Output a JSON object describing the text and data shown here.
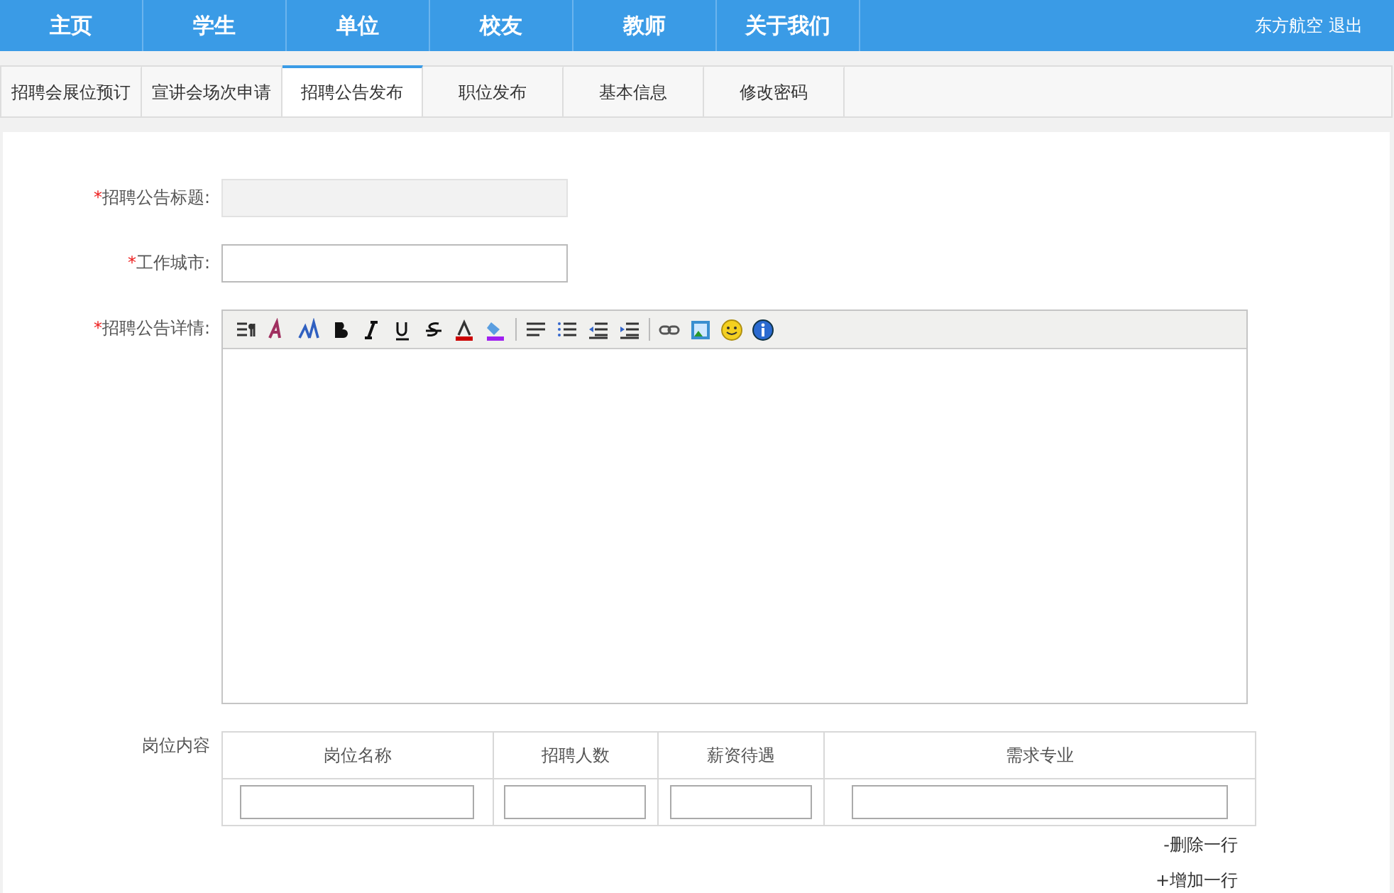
{
  "nav": {
    "items": [
      {
        "label": "主页",
        "selected": false
      },
      {
        "label": "学生",
        "selected": false
      },
      {
        "label": "单位",
        "selected": false
      },
      {
        "label": "校友",
        "selected": false
      },
      {
        "label": "教师",
        "selected": false
      },
      {
        "label": "关于我们",
        "selected": false
      }
    ],
    "user": "东方航空",
    "logout": "退出"
  },
  "tabs": [
    {
      "label": "招聘会展位预订",
      "selected": false
    },
    {
      "label": "宣讲会场次申请",
      "selected": false
    },
    {
      "label": "招聘公告发布",
      "selected": true
    },
    {
      "label": "职位发布",
      "selected": false
    },
    {
      "label": "基本信息",
      "selected": false
    },
    {
      "label": "修改密码",
      "selected": false
    }
  ],
  "form": {
    "fields": [
      {
        "kind": "input",
        "required_mark": "*",
        "label": "招聘公告标题:",
        "disabled": true
      },
      {
        "kind": "input",
        "required_mark": "*",
        "label": "工作城市:",
        "disabled": false
      },
      {
        "kind": "editor",
        "required_mark": "*",
        "label": "招聘公告详情:"
      }
    ],
    "positions": {
      "label": "岗位内容",
      "columns": [
        "岗位名称",
        "招聘人数",
        "薪资待遇",
        "需求专业"
      ],
      "delete_row": "-删除一行",
      "add_row": "+增加一行"
    }
  }
}
